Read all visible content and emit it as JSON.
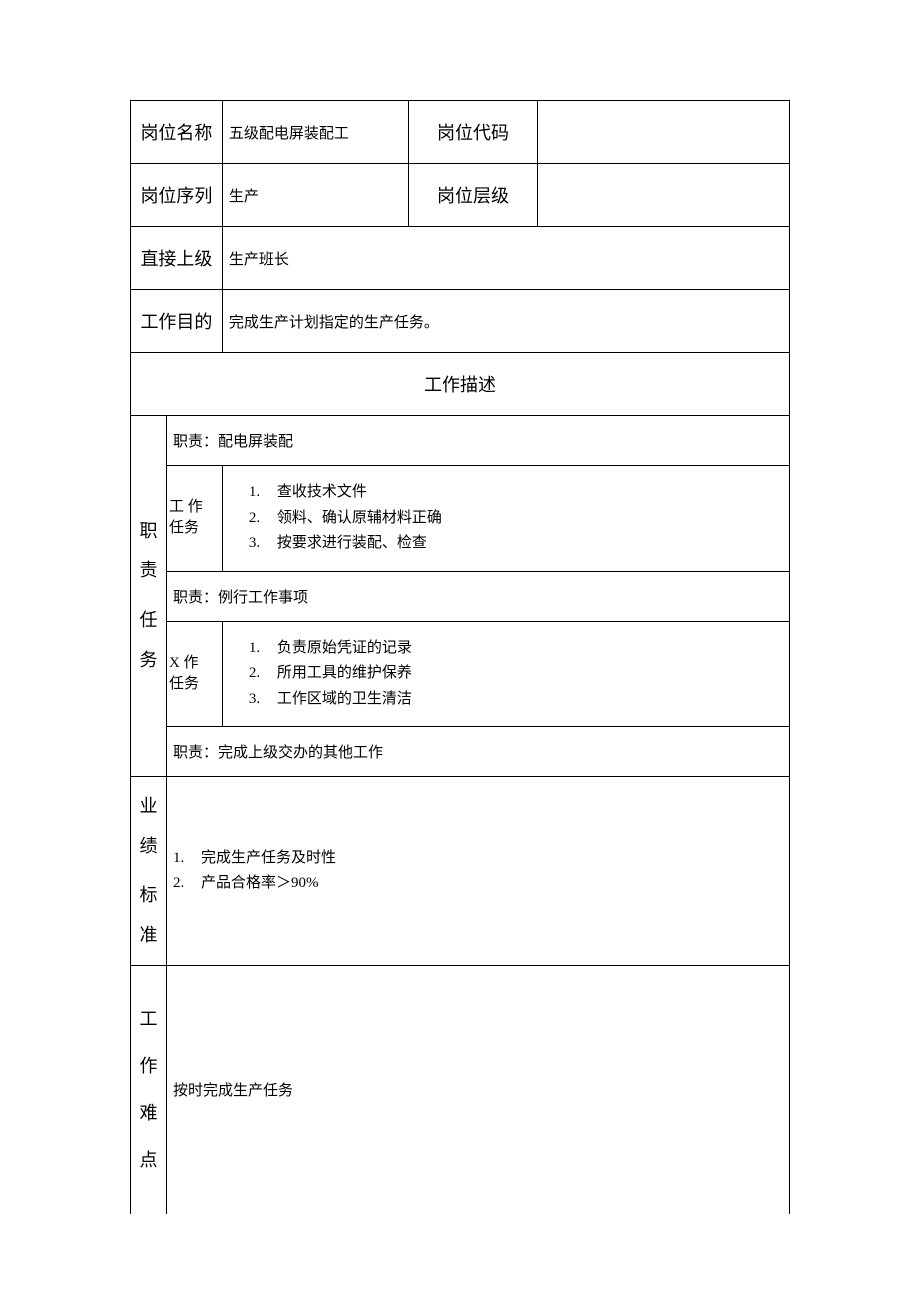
{
  "header": {
    "position_name_label": "岗位名称",
    "position_name_value": "五级配电屏装配工",
    "position_code_label": "岗位代码",
    "position_code_value": "",
    "position_series_label": "岗位序列",
    "position_series_value": "生产",
    "position_level_label": "岗位层级",
    "position_level_value": "",
    "supervisor_label": "直接上级",
    "supervisor_value": "生产班长",
    "purpose_label": "工作目的",
    "purpose_value": "完成生产计划指定的生产任务。"
  },
  "description_header": "工作描述",
  "duties_label_1": "职责",
  "duties_label_2": "任务",
  "duty1": {
    "title": "职责：配电屏装配",
    "task_label_1": "工 作",
    "task_label_2": "任务",
    "tasks": {
      "n1": "1.",
      "t1": "查收技术文件",
      "n2": "2.",
      "t2": "领料、确认原辅材料正确",
      "n3": "3.",
      "t3": "按要求进行装配、检查"
    }
  },
  "duty2": {
    "title": "职责：例行工作事项",
    "task_label_1": "X 作",
    "task_label_2": "任务",
    "tasks": {
      "n1": "1.",
      "t1": "负责原始凭证的记录",
      "n2": "2.",
      "t2": "所用工具的维护保养",
      "n3": "3.",
      "t3": "工作区域的卫生清洁"
    }
  },
  "duty3": {
    "title": "职责：完成上级交办的其他工作"
  },
  "standards": {
    "label_1": "业绩",
    "label_2": "标准",
    "items": {
      "n1": "1.",
      "t1": "完成生产任务及时性",
      "n2": "2.",
      "t2": "产品合格率＞90%"
    }
  },
  "difficulty": {
    "label_1": "工",
    "label_2": "作",
    "label_3": "难",
    "label_4": "点",
    "value": "按时完成生产任务"
  }
}
